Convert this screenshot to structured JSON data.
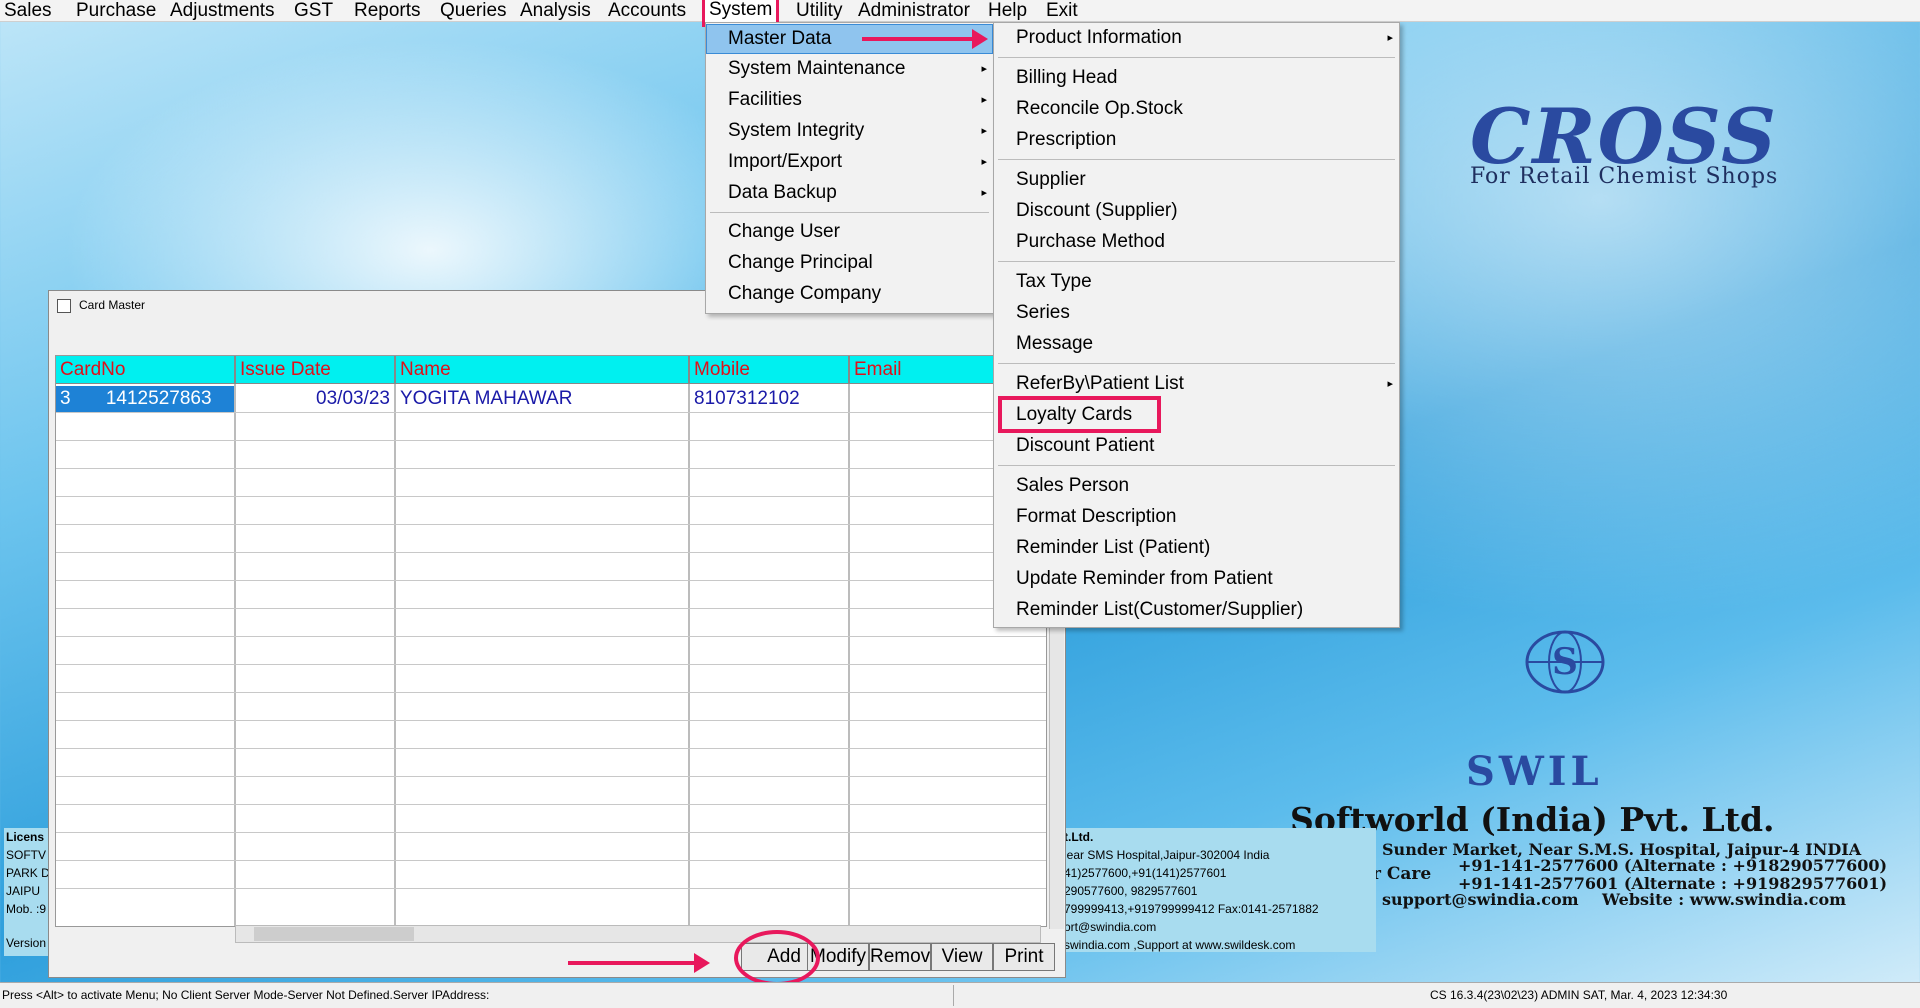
{
  "menubar": {
    "items": [
      "Sales",
      "Purchase",
      "Adjustments",
      "GST",
      "Reports",
      "Queries",
      "Analysis",
      "Accounts",
      "System",
      "Utility",
      "Administrator",
      "Help",
      "Exit"
    ]
  },
  "system_menu": {
    "items": [
      "Master Data",
      "System Maintenance",
      "Facilities",
      "System Integrity",
      "Import/Export",
      "Data Backup",
      "Change User",
      "Change Principal",
      "Change Company"
    ]
  },
  "master_data_menu": {
    "items": [
      "Product Information",
      "Billing Head",
      "Reconcile Op.Stock",
      "Prescription",
      "Supplier",
      "Discount (Supplier)",
      "Purchase Method",
      "Tax Type",
      "Series",
      "Message",
      "ReferBy\\Patient List",
      "Loyalty Cards",
      "Discount Patient",
      "Sales Person",
      "Format Description",
      "Reminder List (Patient)",
      "Update Reminder from Patient",
      "Reminder List(Customer/Supplier)"
    ]
  },
  "card_master": {
    "title": "Card Master",
    "columns": [
      "CardNo",
      "Issue Date",
      "Name",
      "Mobile",
      "Email"
    ],
    "rows": [
      {
        "serial": "3",
        "card_no": "1412527863",
        "issue_date": "03/03/23",
        "name": "YOGITA MAHAWAR",
        "mobile": "8107312102",
        "email": ""
      }
    ],
    "buttons": [
      "Add",
      "Modify",
      "Remove",
      "View",
      "Print"
    ]
  },
  "brand": {
    "title": "CROSS",
    "subtitle": "For Retail Chemist Shops",
    "logo_text": "SWIL",
    "company": "Softworld (India) Pvt. Ltd.",
    "address": "Sunder Market, Near S.M.S. Hospital, Jaipur-4 INDIA",
    "customer_care_label": "r Care",
    "phone1": "+91-141-2577600 (Alternate : +918290577600)",
    "phone2": "+91-141-2577601 (Alternate : +919829577601)",
    "email_line": "support@swindia.com",
    "website_line": "Website : www.swindia.com"
  },
  "info_left": {
    "lines": [
      "Licens",
      "SOFTV",
      "PARK D",
      "JAIPU",
      "Mob. :9",
      "Version"
    ]
  },
  "info_right": {
    "lines": [
      "t.Ltd.",
      "lear SMS Hospital,Jaipur-302004 India",
      "41)2577600,+91(141)2577601",
      "290577600, 9829577601",
      "799999413,+919799999412 Fax:0141-2571882",
      "ort@swindia.com",
      "swindia.com ,Support at www.swildesk.com"
    ]
  },
  "status": {
    "left": "Press <Alt> to activate Menu; No Client Server Mode-Server Not Defined.Server IPAddress:",
    "right": "CS 16.3.4(23\\02\\23) ADMIN  SAT, Mar.  4, 2023  12:34:30"
  },
  "colors": {
    "annotation": "#e8185c",
    "header_bg": "#00f0f0",
    "header_text": "#e0101a",
    "cell_text": "#1a1aa8",
    "selection": "#1e82d6"
  }
}
